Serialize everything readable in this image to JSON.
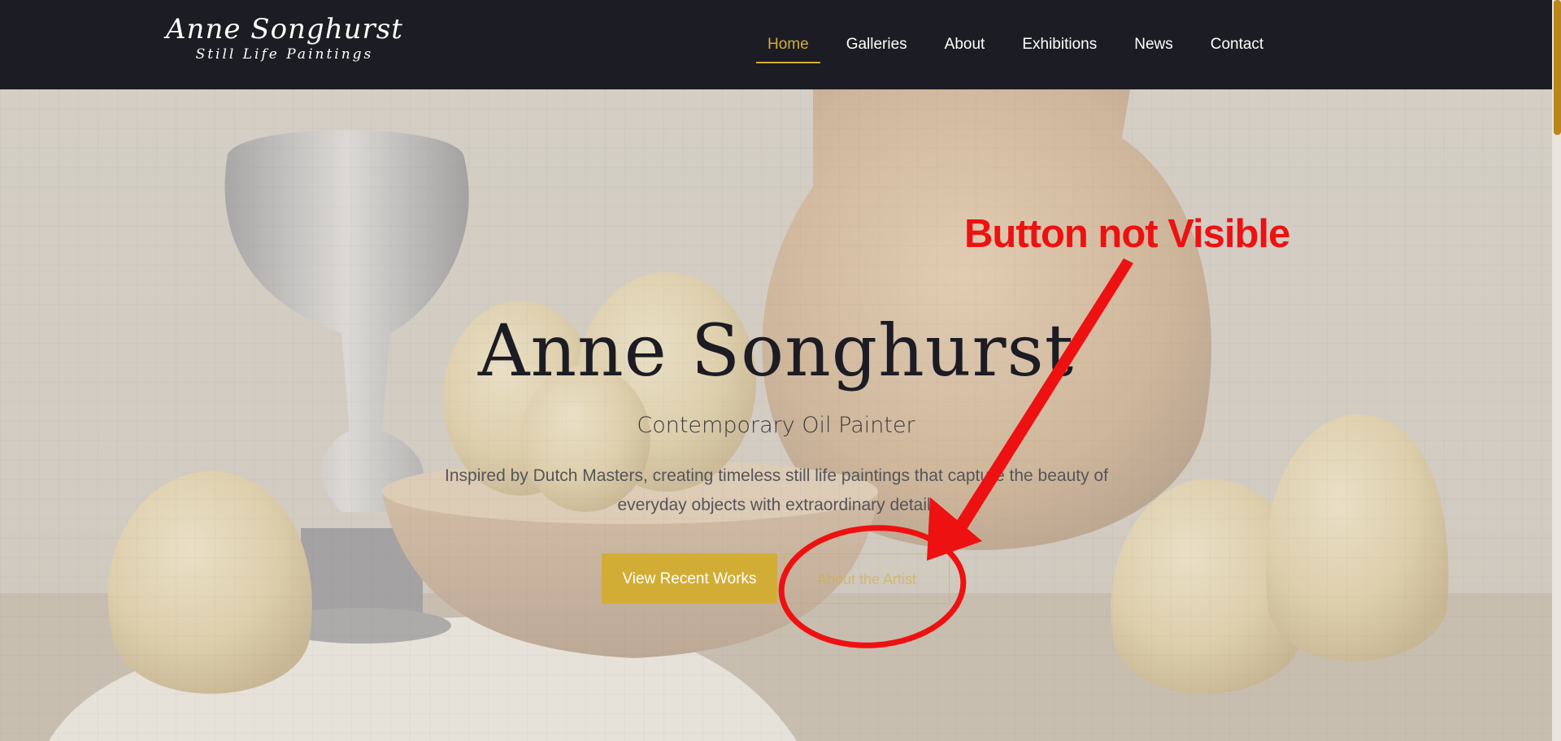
{
  "header": {
    "logo_title": "Anne Songhurst",
    "logo_subtitle": "Still Life Paintings",
    "nav": [
      {
        "label": "Home",
        "active": true
      },
      {
        "label": "Galleries",
        "active": false
      },
      {
        "label": "About",
        "active": false
      },
      {
        "label": "Exhibitions",
        "active": false
      },
      {
        "label": "News",
        "active": false
      },
      {
        "label": "Contact",
        "active": false
      }
    ]
  },
  "hero": {
    "title": "Anne Songhurst",
    "subtitle": "Contemporary Oil Painter",
    "description": "Inspired by Dutch Masters, creating timeless still life paintings that capture the beauty of everyday objects with extraordinary detail.",
    "primary_button": "View Recent Works",
    "secondary_button": "About the Artist"
  },
  "annotation": {
    "text": "Button not Visible",
    "color": "#ee1111"
  },
  "colors": {
    "accent": "#d2ad36",
    "header_bg": "#1c1c24",
    "scroll_thumb": "#b8871b"
  }
}
